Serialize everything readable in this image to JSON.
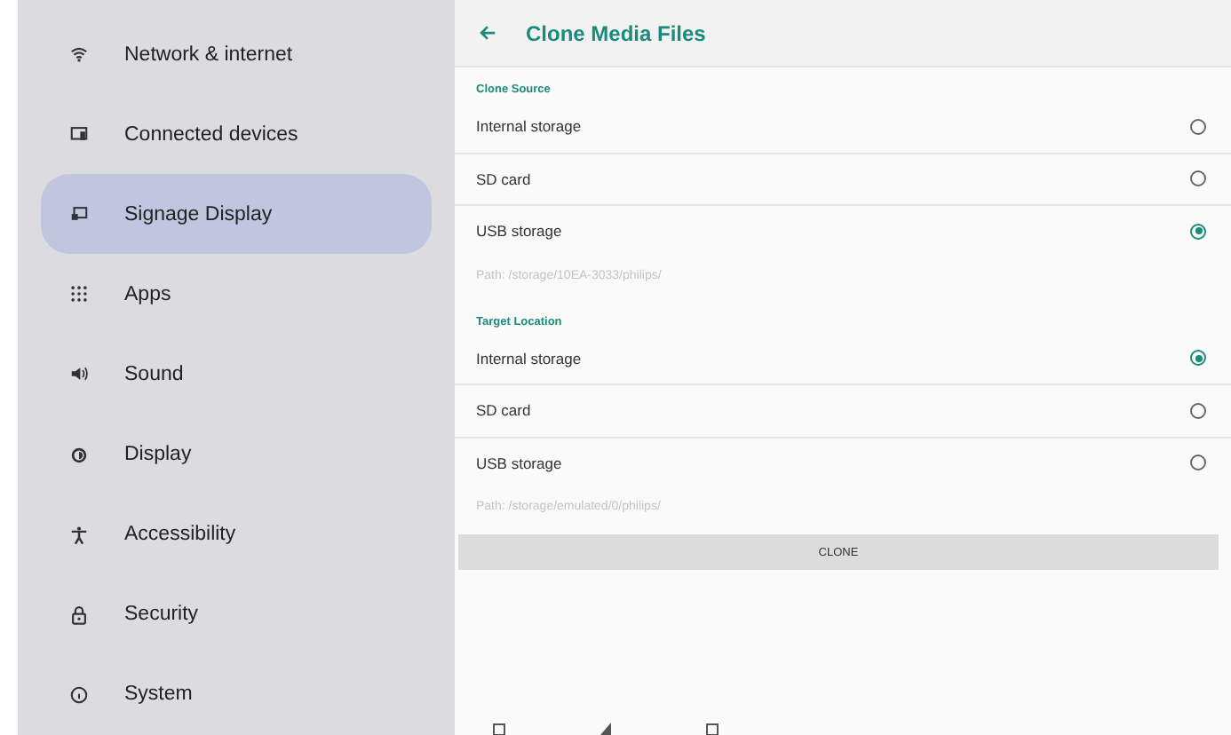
{
  "sidebar": {
    "items": [
      {
        "label": "Network & internet",
        "selected": false
      },
      {
        "label": "Connected devices",
        "selected": false
      },
      {
        "label": "Signage Display",
        "selected": true
      },
      {
        "label": "Apps",
        "selected": false
      },
      {
        "label": "Sound",
        "selected": false
      },
      {
        "label": "Display",
        "selected": false
      },
      {
        "label": "Accessibility",
        "selected": false
      },
      {
        "label": "Security",
        "selected": false
      },
      {
        "label": "System",
        "selected": false
      }
    ]
  },
  "header": {
    "title": "Clone Media Files"
  },
  "sections": [
    {
      "title": "Clone Source",
      "options": [
        {
          "label": "Internal storage",
          "selected": false
        },
        {
          "label": "SD card",
          "selected": false
        },
        {
          "label": "USB storage",
          "selected": true
        }
      ],
      "path": "Path: /storage/10EA-3033/philips/"
    },
    {
      "title": "Target Location",
      "options": [
        {
          "label": "Internal storage",
          "selected": true
        },
        {
          "label": "SD card",
          "selected": false
        },
        {
          "label": "USB storage",
          "selected": false
        }
      ],
      "path": "Path: /storage/emulated/0/philips/"
    }
  ],
  "button": "CLONE"
}
